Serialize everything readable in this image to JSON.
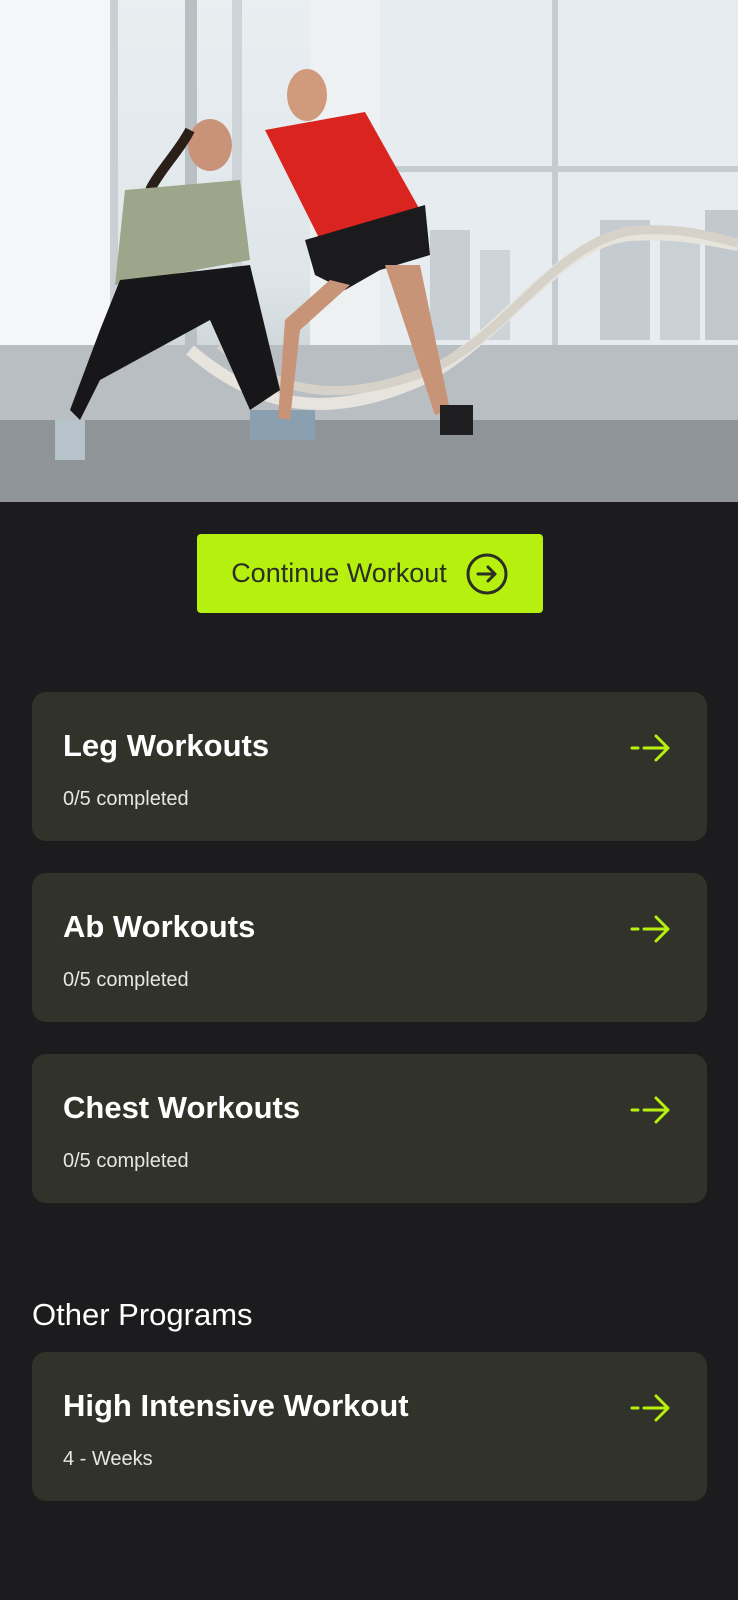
{
  "hero": {
    "image_icon": "workout-photo"
  },
  "continue_button": {
    "label": "Continue Workout",
    "icon": "arrow-circle-right-icon"
  },
  "workouts": [
    {
      "title": "Leg Workouts",
      "subtitle": "0/5 completed"
    },
    {
      "title": "Ab Workouts",
      "subtitle": "0/5 completed"
    },
    {
      "title": "Chest Workouts",
      "subtitle": "0/5 completed"
    }
  ],
  "other_programs": {
    "heading": "Other Programs",
    "items": [
      {
        "title": "High Intensive Workout",
        "subtitle": "4 - Weeks"
      }
    ]
  },
  "colors": {
    "accent": "#b6f00e",
    "background": "#1c1c1e",
    "card": "#31332a"
  }
}
